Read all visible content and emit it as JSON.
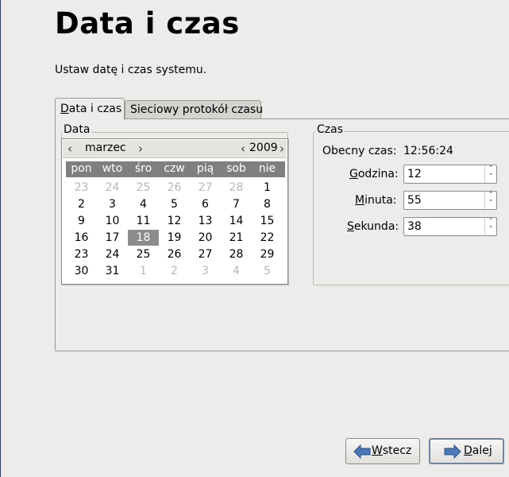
{
  "page": {
    "title": "Data i czas",
    "subtitle": "Ustaw datę i czas systemu."
  },
  "tabs": [
    {
      "mnemonic": "D",
      "rest": "ata i czas",
      "active": true
    },
    {
      "label": "Sieciowy protokół czasu",
      "active": false
    }
  ],
  "date_frame": {
    "label": "Data",
    "month": "marzec",
    "year": "2009",
    "weekdays": [
      "pon",
      "wto",
      "śro",
      "czw",
      "pią",
      "sob",
      "nie"
    ],
    "weeks": [
      [
        "23",
        "24",
        "25",
        "26",
        "27",
        "28",
        "1"
      ],
      [
        "2",
        "3",
        "4",
        "5",
        "6",
        "7",
        "8"
      ],
      [
        "9",
        "10",
        "11",
        "12",
        "13",
        "14",
        "15"
      ],
      [
        "16",
        "17",
        "18",
        "19",
        "20",
        "21",
        "22"
      ],
      [
        "23",
        "24",
        "25",
        "26",
        "27",
        "28",
        "29"
      ],
      [
        "30",
        "31",
        "1",
        "2",
        "3",
        "4",
        "5"
      ]
    ]
  },
  "time_frame": {
    "label": "Czas",
    "current_label": "Obecny czas:",
    "current_value": "12:56:24",
    "hour": {
      "mnemonic": "G",
      "rest": "odzina:",
      "value": "12"
    },
    "minute": {
      "mnemonic": "M",
      "rest": "inuta:",
      "value": "55"
    },
    "second": {
      "mnemonic": "S",
      "rest": "ekunda:",
      "value": "38"
    }
  },
  "buttons": {
    "back": {
      "mnemonic": "W",
      "rest": "stecz"
    },
    "next": {
      "mnemonic": "D",
      "rest": "alej"
    }
  },
  "colors": {
    "selected_day": "#8c8c8c",
    "weekday_header": "#7f7f7f",
    "dim_day": "#b9b7b4"
  },
  "icons": {
    "back": "arrow-left-icon",
    "next": "arrow-right-icon"
  }
}
